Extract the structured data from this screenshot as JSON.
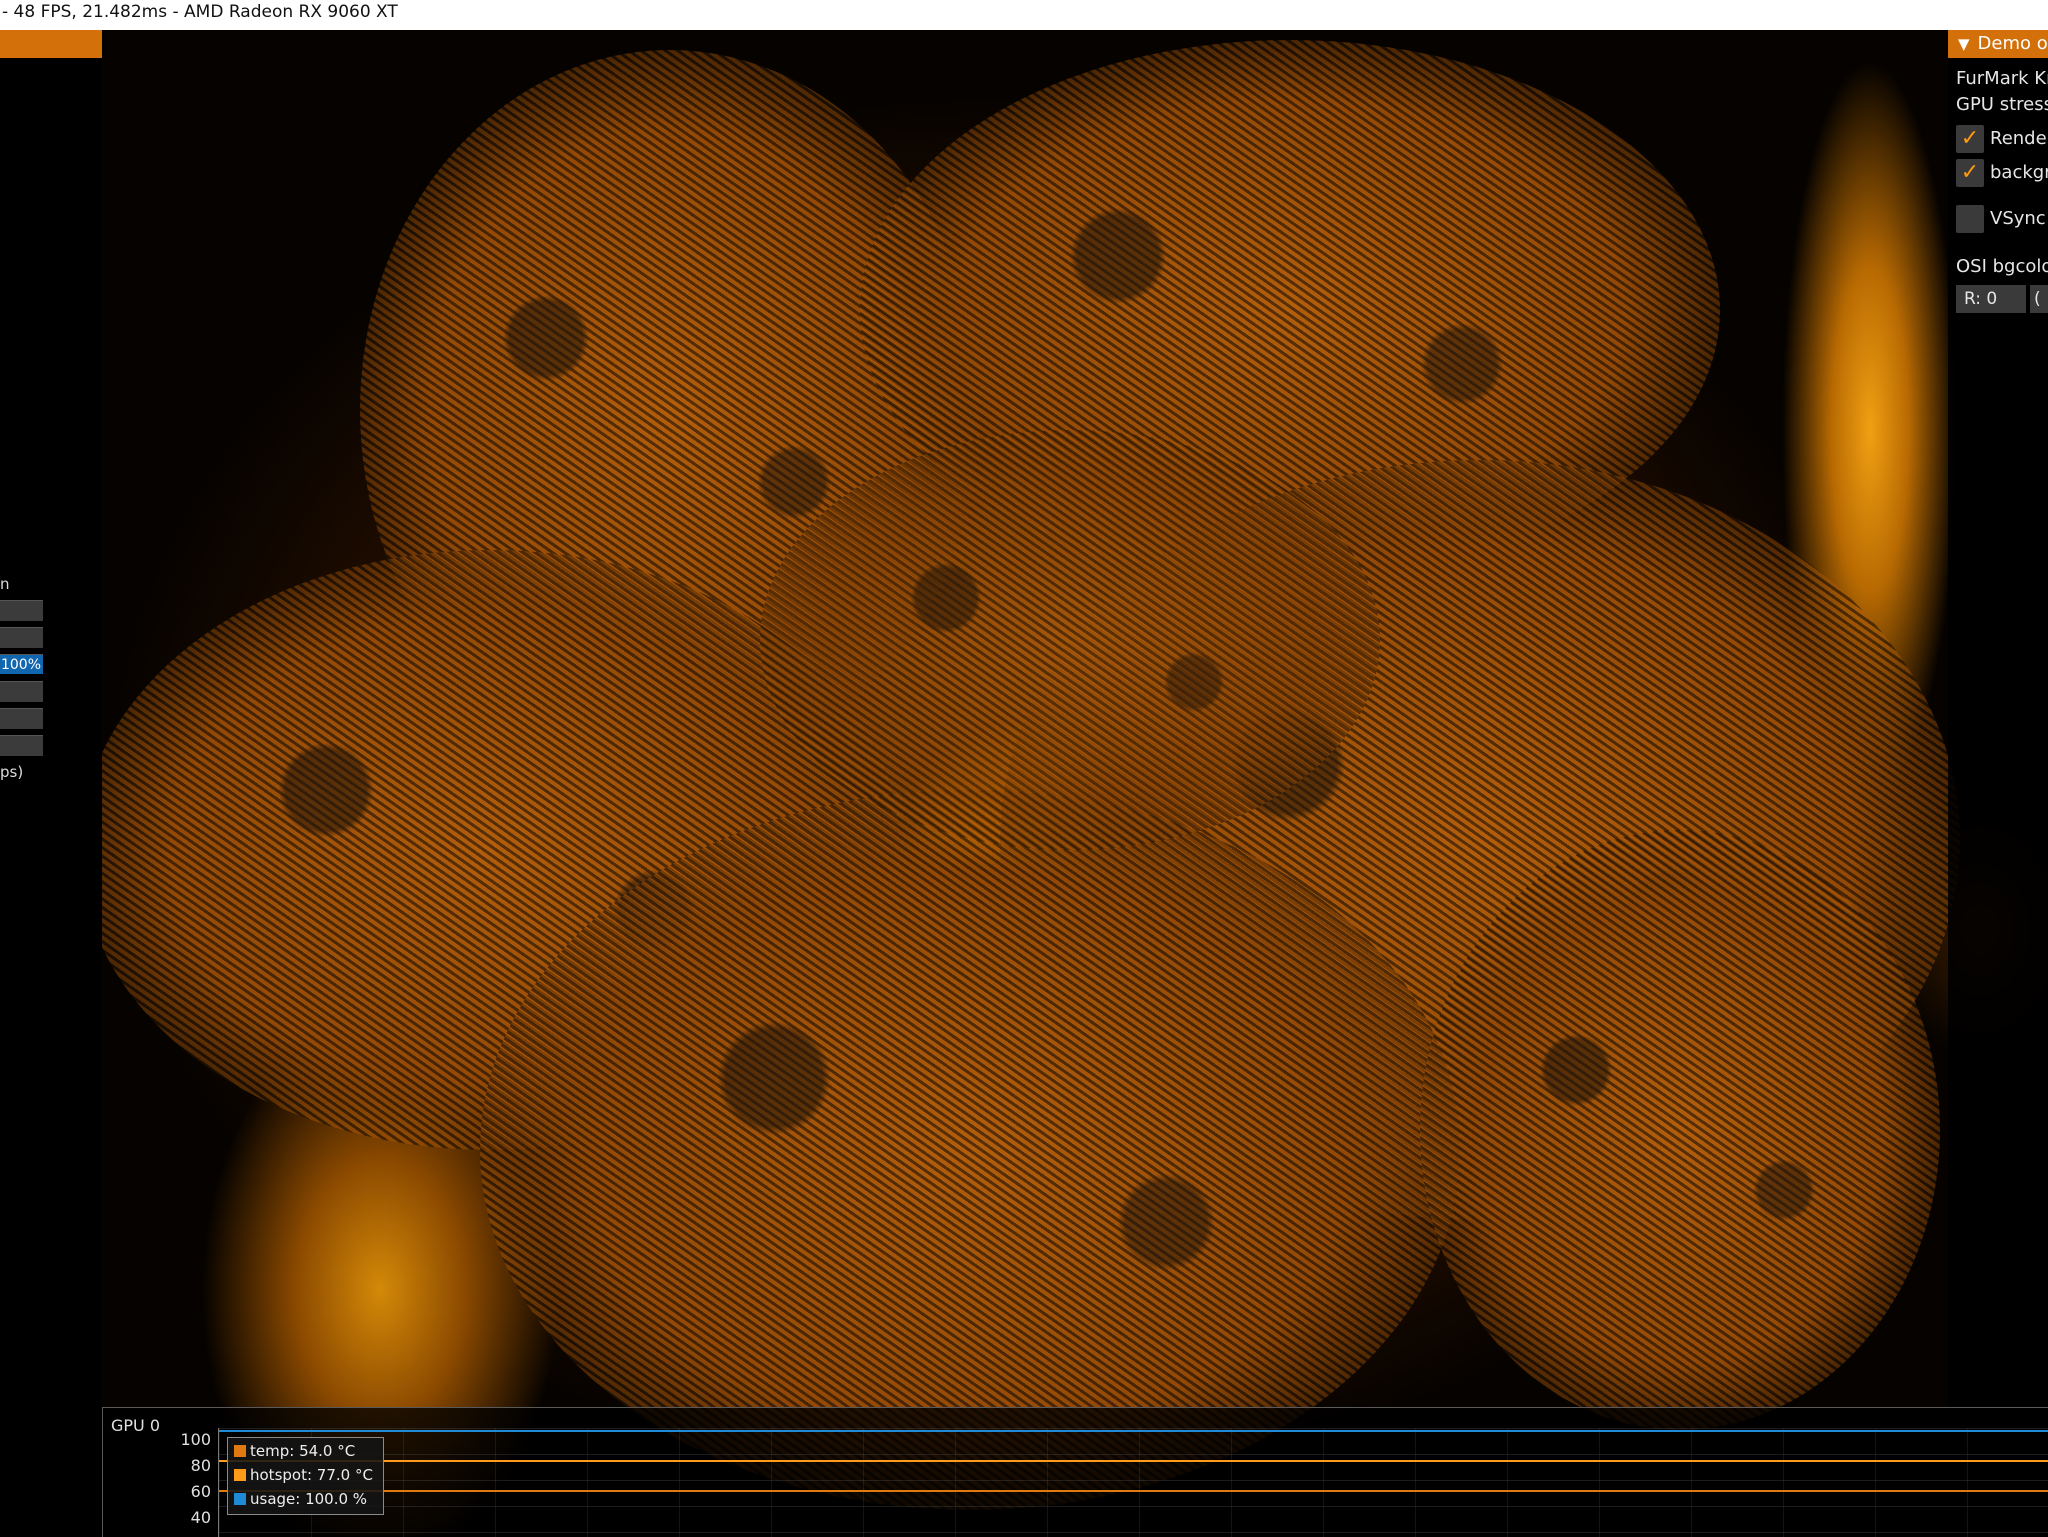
{
  "window": {
    "title": "- 48 FPS, 21.482ms - AMD Radeon RX 9060 XT"
  },
  "left_panel": {
    "partial_label_top": "n",
    "active_bar_value": "100%",
    "partial_label_bottom": "ps)"
  },
  "right_panel": {
    "header": "Demo o",
    "line1": "FurMark Kn",
    "line2": "GPU stress",
    "check_render_label": "Render",
    "check_background_label": "backgr",
    "vsync_label": "VSync",
    "bgcolor_label": "OSI bgcolo",
    "r_field": "R:  0",
    "g_field_partial": "("
  },
  "graph": {
    "title": "GPU 0",
    "y_ticks": [
      "100",
      "80",
      "60",
      "40"
    ],
    "legend": [
      {
        "label": "temp: 54.0 °C",
        "color": "#e07a10",
        "value": 54.0
      },
      {
        "label": "hotspot: 77.0 °C",
        "color": "#ff9a1a",
        "value": 77.0
      },
      {
        "label": "usage: 100.0 %",
        "color": "#1f8ad6",
        "value": 100.0
      }
    ],
    "ylim": [
      40,
      100
    ]
  },
  "colors": {
    "accent_orange": "#d3700a",
    "check_orange": "#ff9a12",
    "active_blue": "#1166b0"
  }
}
